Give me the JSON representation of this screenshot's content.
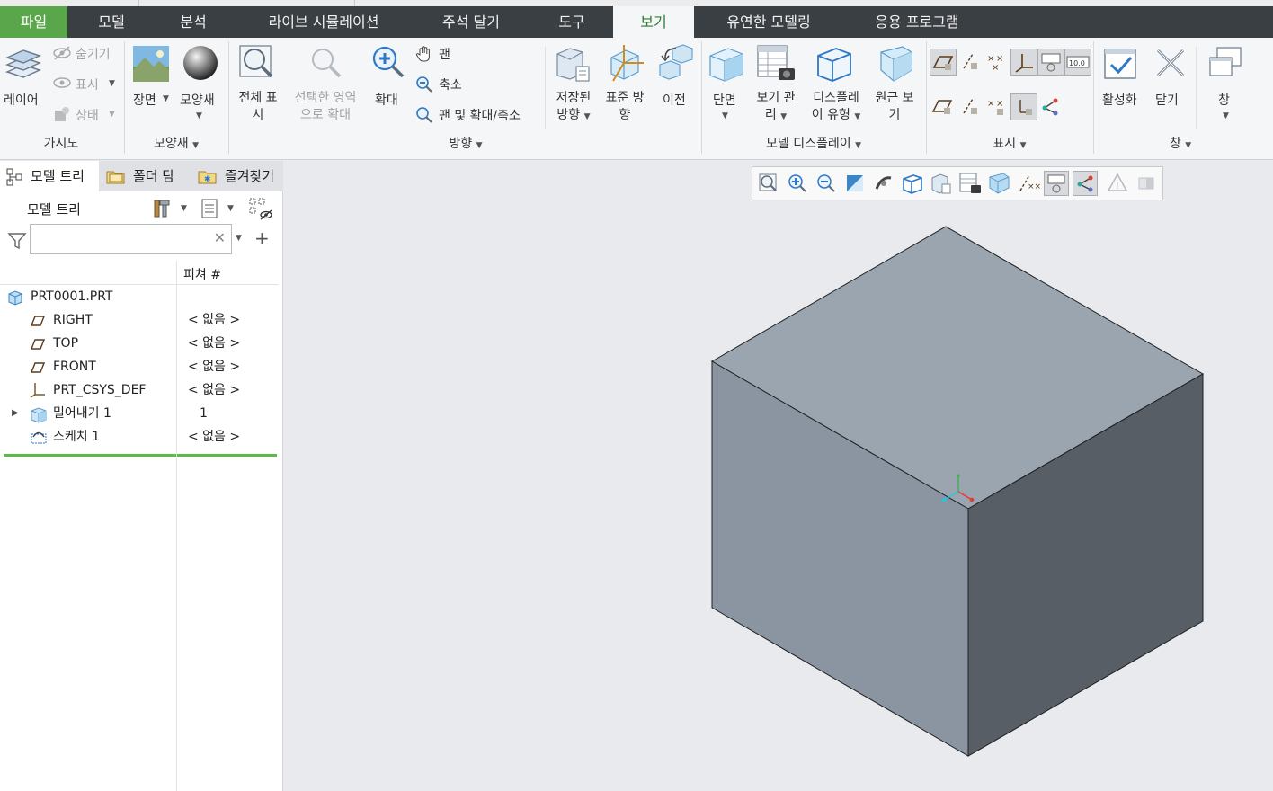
{
  "tabs": [
    {
      "label": "파일",
      "name": "tab-file"
    },
    {
      "label": "모델",
      "name": "tab-model"
    },
    {
      "label": "분석",
      "name": "tab-analysis"
    },
    {
      "label": "라이브 시뮬레이션",
      "name": "tab-live-simulation"
    },
    {
      "label": "주석 달기",
      "name": "tab-annotate"
    },
    {
      "label": "도구",
      "name": "tab-tools"
    },
    {
      "label": "보기",
      "name": "tab-view"
    },
    {
      "label": "유연한 모델링",
      "name": "tab-flexible-modeling"
    },
    {
      "label": "응용 프로그램",
      "name": "tab-applications"
    }
  ],
  "ribbon": {
    "visibility": {
      "layer": "레이어",
      "hide": "숨기기",
      "show": "표시",
      "status": "상태",
      "group": "가시도"
    },
    "appearance": {
      "scene": "장면",
      "appearance": "모양새",
      "group": "모양새"
    },
    "orientation": {
      "refit_1": "전체 표",
      "refit_2": "시",
      "zoom_sel_1": "선택한 영역",
      "zoom_sel_2": "으로 확대",
      "zoom_in": "확대",
      "pan": "팬",
      "zoom_out": "축소",
      "pan_zoom": "팬 및 확대/축소",
      "saved_1": "저장된",
      "saved_2": "방향",
      "std_1": "표준 방",
      "std_2": "향",
      "prev": "이전",
      "group": "방향"
    },
    "model_display": {
      "section": "단면",
      "manager_1": "보기 관",
      "manager_2": "리",
      "style_1": "디스플레",
      "style_2": "이 유형",
      "persp_1": "원근 보",
      "persp_2": "기",
      "group": "모델 디스플레이"
    },
    "show": {
      "group": "표시",
      "annotation_text": "10.0"
    },
    "window": {
      "activate": "활성화",
      "close": "닫기",
      "windows": "창",
      "group": "창"
    }
  },
  "panel": {
    "tabs": [
      {
        "label": "모델 트리"
      },
      {
        "label": "폴더 탐"
      },
      {
        "label": "즐겨찾기"
      }
    ],
    "title": "모델 트리",
    "search_value": "",
    "col_feature": "피쳐 #",
    "root": "PRT0001.PRT",
    "items": [
      {
        "name": "RIGHT",
        "feat": "< 없음 >",
        "icon": "datum-plane-icon"
      },
      {
        "name": "TOP",
        "feat": "< 없음 >",
        "icon": "datum-plane-icon"
      },
      {
        "name": "FRONT",
        "feat": "< 없음 >",
        "icon": "datum-plane-icon"
      },
      {
        "name": "PRT_CSYS_DEF",
        "feat": "< 없음 >",
        "icon": "coordinate-system-icon"
      },
      {
        "name": "밀어내기 1",
        "feat": "1",
        "icon": "extrude-icon"
      },
      {
        "name": "스케치 1",
        "feat": "< 없음 >",
        "icon": "sketch-icon"
      }
    ]
  },
  "colors": {
    "tabbar": "#3a3f44",
    "file_tab": "#5aa64a",
    "active_tab_text": "#2e7d32",
    "cube_top": "#9ba5b0",
    "cube_left": "#8b95a1",
    "cube_right": "#585e66",
    "insert_line": "#5fb84a"
  }
}
